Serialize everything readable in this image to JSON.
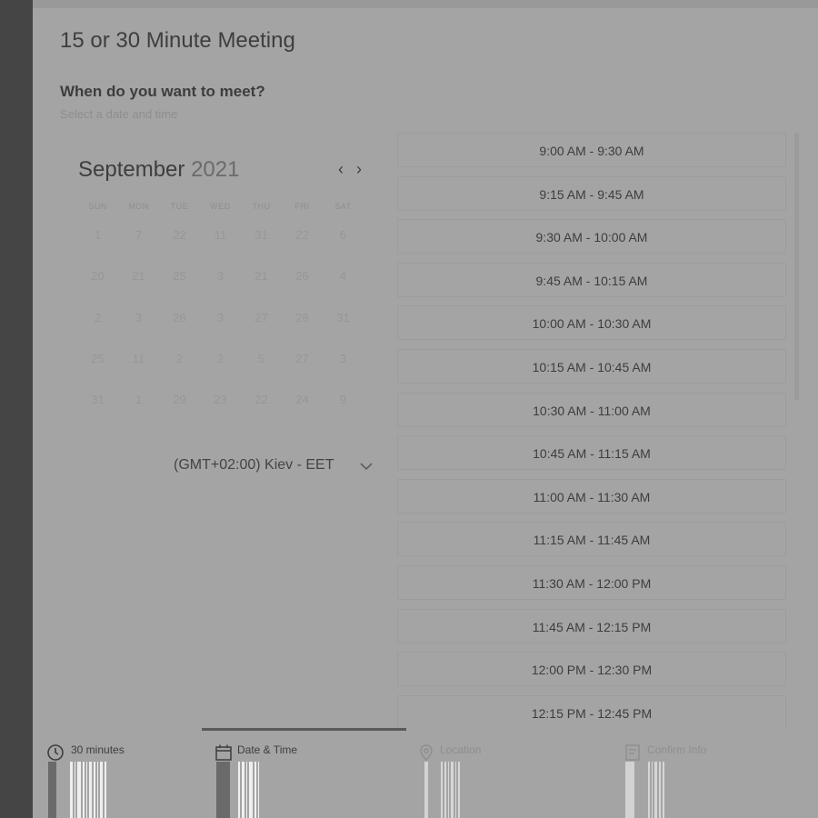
{
  "page": {
    "title": "15 or 30 Minute Meeting",
    "question": "When do you want to meet?",
    "hint": "Select a date and time"
  },
  "calendar": {
    "month": "September",
    "year": "2021",
    "weekdays": [
      "SUN",
      "MON",
      "TUE",
      "WED",
      "THU",
      "FRI",
      "SAT"
    ],
    "days": [
      [
        "1",
        "7",
        "22",
        "11",
        "31",
        "22",
        "6"
      ],
      [
        "20",
        "21",
        "25",
        "3",
        "21",
        "26",
        "4"
      ],
      [
        "2",
        "3",
        "28",
        "3",
        "27",
        "28",
        "31"
      ],
      [
        "25",
        "11",
        "2",
        "2",
        "5",
        "27",
        "3"
      ],
      [
        "31",
        "1",
        "29",
        "23",
        "22",
        "24",
        "9"
      ]
    ]
  },
  "timezone": {
    "label": "(GMT+02:00) Kiev - EET"
  },
  "time_slots": [
    "9:00 AM - 9:30 AM",
    "9:15 AM - 9:45 AM",
    "9:30 AM - 10:00 AM",
    "9:45 AM - 10:15 AM",
    "10:00 AM - 10:30 AM",
    "10:15 AM - 10:45 AM",
    "10:30 AM - 11:00 AM",
    "10:45 AM - 11:15 AM",
    "11:00 AM - 11:30 AM",
    "11:15 AM - 11:45 AM",
    "11:30 AM - 12:00 PM",
    "11:45 AM - 12:15 PM",
    "12:00 PM - 12:30 PM",
    "12:15 PM - 12:45 PM"
  ],
  "steps": [
    {
      "label": "30 minutes",
      "icon": "clock-icon",
      "state": "done"
    },
    {
      "label": "Date & Time",
      "icon": "calendar-icon",
      "state": "active"
    },
    {
      "label": "Location",
      "icon": "location-pin-icon",
      "state": "pending"
    },
    {
      "label": "Confirm Info",
      "icon": "document-icon",
      "state": "pending"
    }
  ],
  "colors": {
    "page_background": "#454545",
    "panel_background": "#a4a4a4",
    "text_dark": "#3d3d3d",
    "text_muted": "#8e8e8e",
    "active_step_line": "#5a5a5a"
  }
}
